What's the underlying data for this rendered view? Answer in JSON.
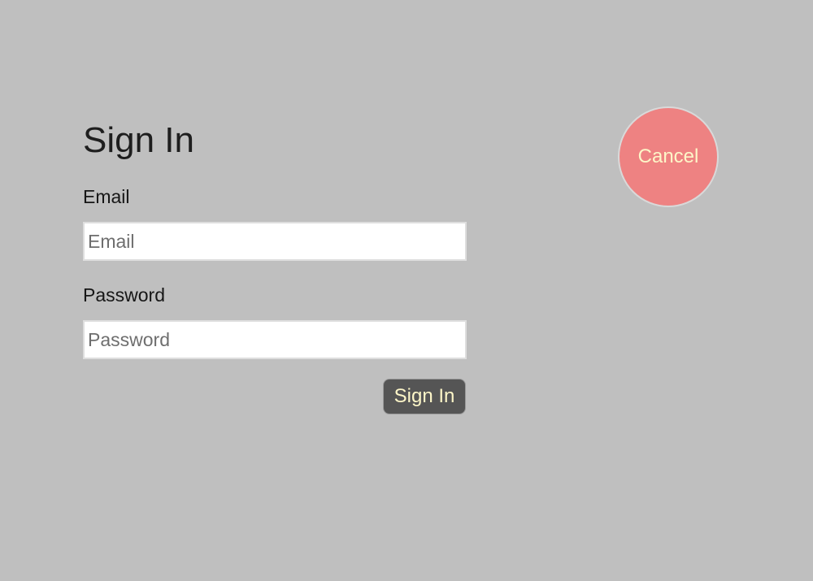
{
  "signin_form": {
    "title": "Sign In",
    "email": {
      "label": "Email",
      "value": "",
      "placeholder": "Email"
    },
    "password": {
      "label": "Password",
      "value": "",
      "placeholder": "Password"
    },
    "submit_label": "Sign In"
  },
  "cancel": {
    "label": "Cancel"
  },
  "colors": {
    "background": "#bfbfbf",
    "submit_button": "#555555",
    "cancel_button": "#ee8282",
    "button_text": "#fdf6c8"
  }
}
